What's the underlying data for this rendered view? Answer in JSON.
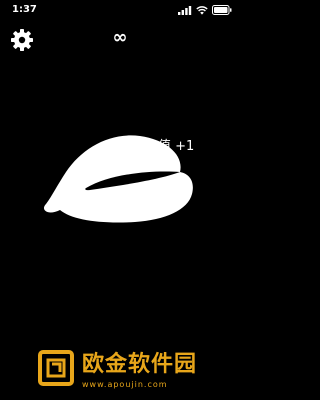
{
  "status_bar": {
    "time": "1:37",
    "icons": [
      "signal-icon",
      "wifi-icon",
      "battery-icon"
    ]
  },
  "toolbar": {
    "settings_icon": "gear-icon",
    "counter": "∞"
  },
  "main": {
    "floating_text": "静心值 +1",
    "wooden_fish_icon": "wooden-fish-icon"
  },
  "watermark": {
    "title": "欧金软件园",
    "url": "www.apoujin.com",
    "color": "#e8a61a"
  },
  "colors": {
    "background": "#000000",
    "foreground": "#ffffff"
  }
}
